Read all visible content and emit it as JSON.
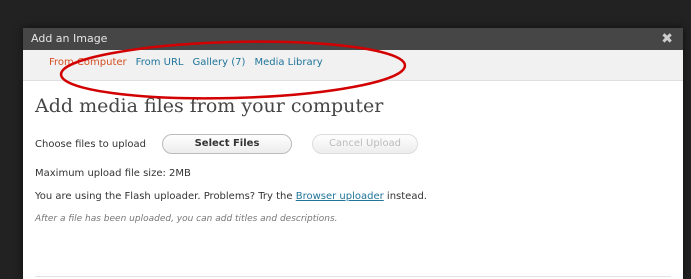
{
  "window": {
    "title": "Add an Image",
    "close_glyph": "✖"
  },
  "tabs": [
    {
      "label": "From Computer",
      "active": true
    },
    {
      "label": "From URL",
      "active": false
    },
    {
      "label": "Gallery (7)",
      "active": false
    },
    {
      "label": "Media Library",
      "active": false
    }
  ],
  "heading": "Add media files from your computer",
  "upload": {
    "choose_label": "Choose files to upload",
    "select_button": "Select Files",
    "cancel_button": "Cancel Upload"
  },
  "max_size": "Maximum upload file size: 2MB",
  "flash_notice": {
    "prefix": "You are using the Flash uploader. Problems? Try the ",
    "link": "Browser uploader",
    "suffix": " instead."
  },
  "after_note": "After a file has been uploaded, you can add titles and descriptions.",
  "colors": {
    "annotation": "#d20000",
    "active_tab": "#d54e21",
    "link": "#21759b"
  }
}
